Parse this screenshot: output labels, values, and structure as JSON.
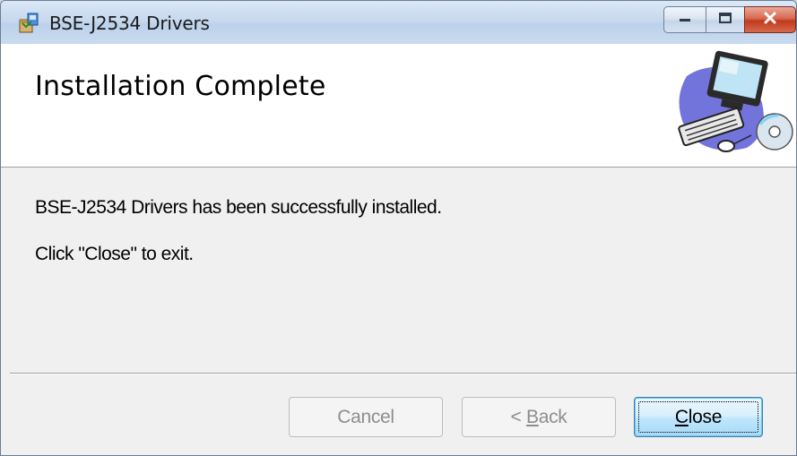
{
  "window": {
    "title": "BSE-J2534 Drivers",
    "accent": "#c7d9ee",
    "close_color": "#c2391d",
    "icons": {
      "app": "installer-package-icon",
      "minimize": "minimize-icon",
      "maximize": "maximize-icon",
      "close": "close-icon"
    }
  },
  "banner": {
    "heading": "Installation Complete",
    "art": "computer-with-disc-icon"
  },
  "body": {
    "message": "BSE-J2534 Drivers has been successfully installed.",
    "instruction": "Click \"Close\" to exit."
  },
  "buttons": {
    "cancel": "Cancel",
    "back_arrow": "< ",
    "back_mnemonic": "B",
    "back_rest": "ack",
    "close_mnemonic": "C",
    "close_rest": "lose"
  }
}
